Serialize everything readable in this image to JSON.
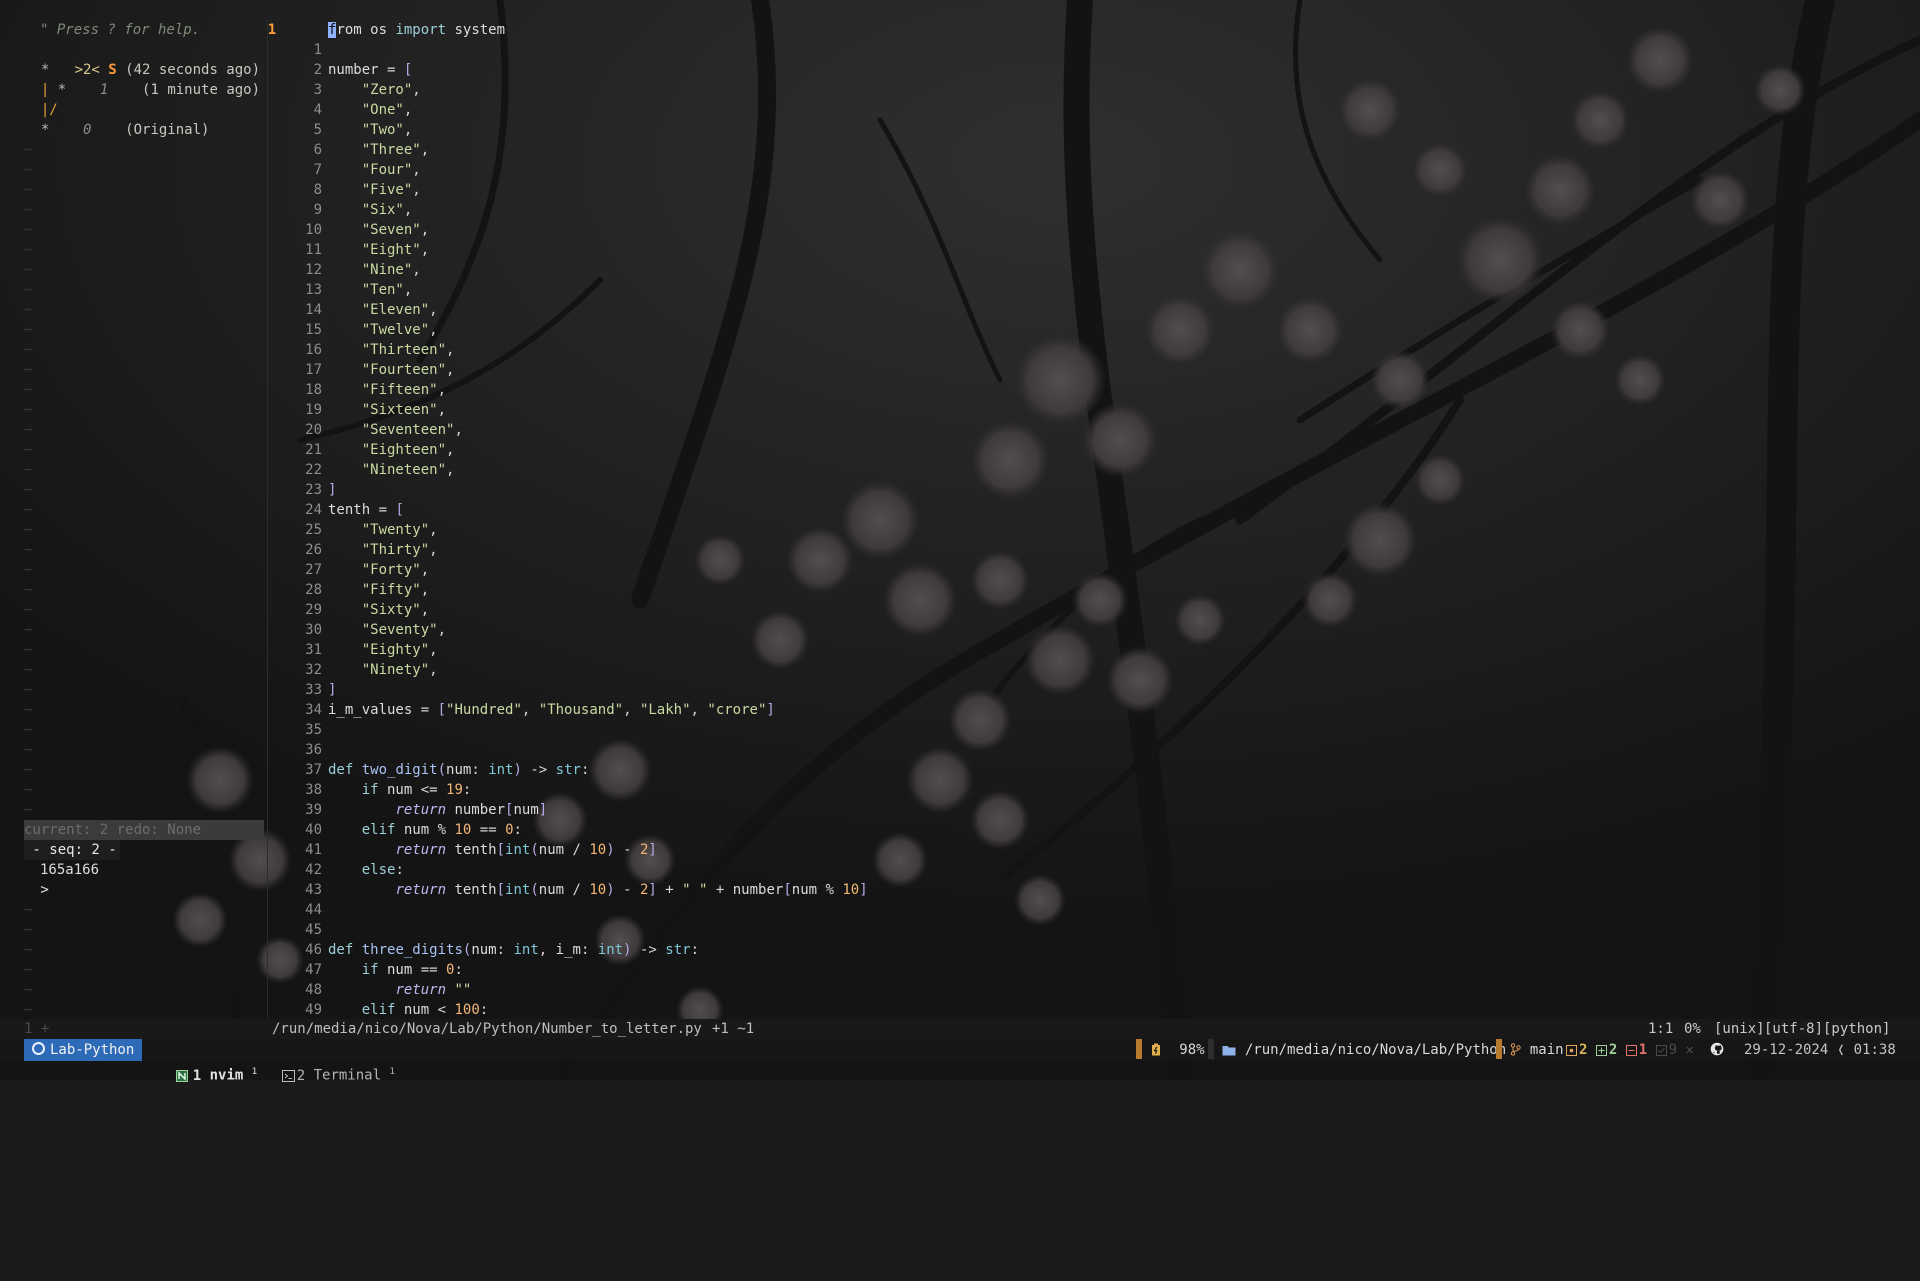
{
  "undotree": {
    "help": "\" Press ? for help.",
    "tree_lines": [
      {
        "graph": "  *   ",
        "seq": ">2<",
        "flag": "S",
        "time": "(42 seconds ago)",
        "kind": "current"
      },
      {
        "graph": "  | *    ",
        "seq": "1",
        "flag": "",
        "time": "(1 minute ago)",
        "kind": "old"
      },
      {
        "graph": "  |/",
        "seq": "",
        "flag": "",
        "time": "",
        "kind": "branch"
      },
      {
        "graph": "  *    ",
        "seq": "0",
        "flag": "",
        "time": "(Original)",
        "kind": "old"
      }
    ],
    "status": "current: 2 redo: None",
    "diff": {
      "header": " - seq: 2 -",
      "hunk": "165a166",
      "added": " >"
    }
  },
  "editor": {
    "cursor_line": 1,
    "lines": [
      {
        "n": "1",
        "src": "from os import system"
      },
      {
        "n": "1",
        "src": ""
      },
      {
        "n": "2",
        "src": "number = ["
      },
      {
        "n": "3",
        "src": "    \"Zero\","
      },
      {
        "n": "4",
        "src": "    \"One\","
      },
      {
        "n": "5",
        "src": "    \"Two\","
      },
      {
        "n": "6",
        "src": "    \"Three\","
      },
      {
        "n": "7",
        "src": "    \"Four\","
      },
      {
        "n": "8",
        "src": "    \"Five\","
      },
      {
        "n": "9",
        "src": "    \"Six\","
      },
      {
        "n": "10",
        "src": "    \"Seven\","
      },
      {
        "n": "11",
        "src": "    \"Eight\","
      },
      {
        "n": "12",
        "src": "    \"Nine\","
      },
      {
        "n": "13",
        "src": "    \"Ten\","
      },
      {
        "n": "14",
        "src": "    \"Eleven\","
      },
      {
        "n": "15",
        "src": "    \"Twelve\","
      },
      {
        "n": "16",
        "src": "    \"Thirteen\","
      },
      {
        "n": "17",
        "src": "    \"Fourteen\","
      },
      {
        "n": "18",
        "src": "    \"Fifteen\","
      },
      {
        "n": "19",
        "src": "    \"Sixteen\","
      },
      {
        "n": "20",
        "src": "    \"Seventeen\","
      },
      {
        "n": "21",
        "src": "    \"Eighteen\","
      },
      {
        "n": "22",
        "src": "    \"Nineteen\","
      },
      {
        "n": "23",
        "src": "]"
      },
      {
        "n": "24",
        "src": "tenth = ["
      },
      {
        "n": "25",
        "src": "    \"Twenty\","
      },
      {
        "n": "26",
        "src": "    \"Thirty\","
      },
      {
        "n": "27",
        "src": "    \"Forty\","
      },
      {
        "n": "28",
        "src": "    \"Fifty\","
      },
      {
        "n": "29",
        "src": "    \"Sixty\","
      },
      {
        "n": "30",
        "src": "    \"Seventy\","
      },
      {
        "n": "31",
        "src": "    \"Eighty\","
      },
      {
        "n": "32",
        "src": "    \"Ninety\","
      },
      {
        "n": "33",
        "src": "]"
      },
      {
        "n": "34",
        "src": "i_m_values = [\"Hundred\", \"Thousand\", \"Lakh\", \"crore\"]"
      },
      {
        "n": "35",
        "src": ""
      },
      {
        "n": "36",
        "src": ""
      },
      {
        "n": "37",
        "src": "def two_digit(num: int) -> str:"
      },
      {
        "n": "38",
        "src": "    if num <= 19:"
      },
      {
        "n": "39",
        "src": "        return number[num]"
      },
      {
        "n": "40",
        "src": "    elif num % 10 == 0:"
      },
      {
        "n": "41",
        "src": "        return tenth[int(num / 10) - 2]"
      },
      {
        "n": "42",
        "src": "    else:"
      },
      {
        "n": "43",
        "src": "        return tenth[int(num / 10) - 2] + \" \" + number[num % 10]"
      },
      {
        "n": "44",
        "src": ""
      },
      {
        "n": "45",
        "src": ""
      },
      {
        "n": "46",
        "src": "def three_digits(num: int, i_m: int) -> str:"
      },
      {
        "n": "47",
        "src": "    if num == 0:"
      },
      {
        "n": "48",
        "src": "        return \"\""
      },
      {
        "n": "49",
        "src": "    elif num < 100:"
      }
    ]
  },
  "winbar": {
    "left": "1 +",
    "path": "/run/media/nico/Nova/Lab/Python/Number_to_letter.py",
    "diff": "+1 ~1",
    "position": "1:1",
    "percent": "0%",
    "fileformat": "[unix]",
    "encoding": "[utf-8]",
    "filetype": "[python]"
  },
  "tmux": {
    "session": "Lab-Python",
    "windows": [
      {
        "index": "1",
        "name": "nvim",
        "flag": "1",
        "icon": "nvim-icon"
      },
      {
        "index": "2",
        "name": "Terminal",
        "flag": "1",
        "icon": "terminal-icon"
      }
    ],
    "battery": "98%",
    "cwd": "/run/media/nico/Nova/Lab/Python",
    "branch": "main",
    "git": {
      "staged": "2",
      "added": "2",
      "deleted": "1",
      "checked": "9"
    },
    "date": "29-12-2024",
    "time": "01:38",
    "colors": {
      "session_bg": "#2d6ab8",
      "accent": "#b87a2d",
      "cursor_line_nr": "#ff9e3b"
    }
  }
}
